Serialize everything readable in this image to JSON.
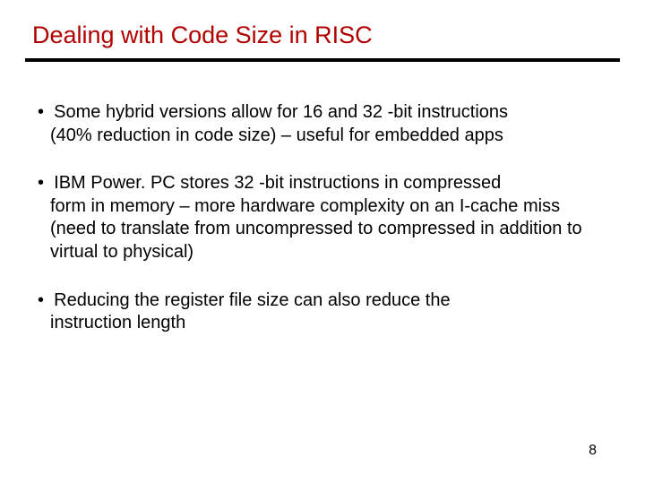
{
  "slide": {
    "title": "Dealing with Code Size in RISC",
    "bullets": [
      {
        "line1": "Some hybrid versions allow for 16 and 32 -bit instructions",
        "line2": "(40% reduction in code size) – useful for embedded apps"
      },
      {
        "line1": "IBM Power. PC stores 32 -bit instructions in compressed",
        "line2": "form in memory – more hardware complexity on an I-cache miss (need to translate from uncompressed to compressed in addition to virtual to physical)"
      },
      {
        "line1": "Reducing the register file size can also reduce the",
        "line2": "instruction length"
      }
    ],
    "page_number": "8",
    "bullet_char": "•"
  }
}
